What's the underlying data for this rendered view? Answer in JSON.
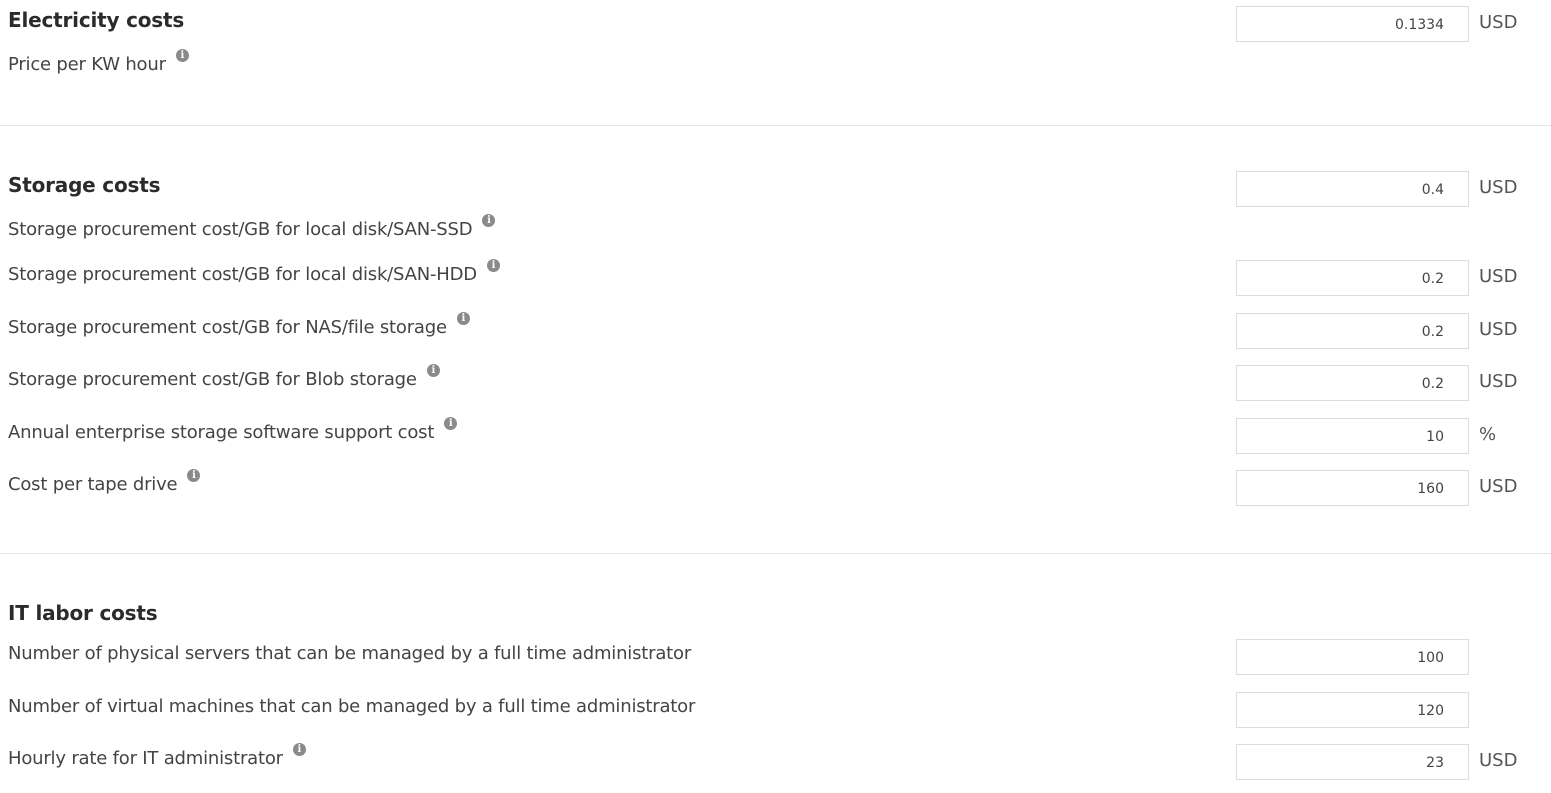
{
  "sections": {
    "electricity": {
      "title": "Electricity costs",
      "rows": [
        {
          "label": "Price per KW hour",
          "value": "0.1334",
          "unit": "USD"
        }
      ]
    },
    "storage": {
      "title": "Storage costs",
      "rows": [
        {
          "label": "Storage procurement cost/GB for local disk/SAN-SSD",
          "value": "0.4",
          "unit": "USD"
        },
        {
          "label": "Storage procurement cost/GB for local disk/SAN-HDD",
          "value": "0.2",
          "unit": "USD"
        },
        {
          "label": "Storage procurement cost/GB for NAS/file storage",
          "value": "0.2",
          "unit": "USD"
        },
        {
          "label": "Storage procurement cost/GB for Blob storage",
          "value": "0.2",
          "unit": "USD"
        },
        {
          "label": "Annual enterprise storage software support cost",
          "value": "10",
          "unit": "%"
        },
        {
          "label": "Cost per tape drive",
          "value": "160",
          "unit": "USD"
        }
      ]
    },
    "labor": {
      "title": "IT labor costs",
      "rows": [
        {
          "label": "Number of physical servers that can be managed by a full time administrator",
          "value": "100",
          "unit": ""
        },
        {
          "label": "Number of virtual machines that can be managed by a full time administrator",
          "value": "120",
          "unit": ""
        },
        {
          "label": "Hourly rate for IT administrator",
          "value": "23",
          "unit": "USD"
        }
      ]
    }
  },
  "icons": {
    "info": "i"
  }
}
